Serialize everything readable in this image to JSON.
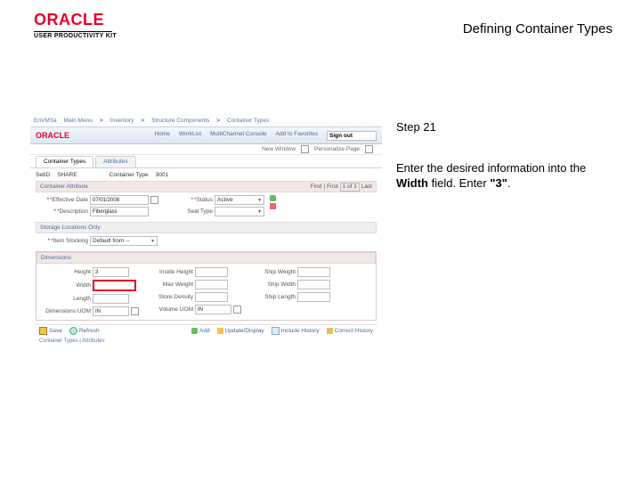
{
  "brand": {
    "oracle": "ORACLE",
    "sub": "USER PRODUCTIVITY KIT"
  },
  "title": "Defining Container Types",
  "instr": {
    "step": "Step 21",
    "line1": "Enter the desired information into the ",
    "bold": "Width",
    "line2": " field. Enter ",
    "quoted": "\"3\"",
    "line3": "."
  },
  "shot": {
    "bc": {
      "a": "EnVMSa",
      "b": "Main Menu",
      "c": "Inventory",
      "d": "Structure Components",
      "e": "Container Types"
    },
    "nav": {
      "a": "Home",
      "b": "WorkList",
      "c": "MultiChannel Console",
      "d": "Add to Favorites",
      "e": "Sign out"
    },
    "subrow": {
      "a": "New Window",
      "b": "Personalize Page"
    },
    "tabs": {
      "a": "Container Types",
      "b": "Attributes"
    },
    "hdr": {
      "setid_lbl": "SetID",
      "setid_val": "SHARE",
      "ct_lbl": "Container Type",
      "ct_val": "3001"
    },
    "pager": {
      "find": "Find",
      "first": "First",
      "ix": "1 of 1",
      "last": "Last"
    },
    "fields": {
      "effdate_lbl": "*Effective Date",
      "effdate_val": "07/01/2008",
      "status_lbl": "*Status",
      "status_val": "Active",
      "desc_lbl": "*Description",
      "desc_val": "Fiberglass",
      "seal_lbl": "Seal Type",
      "seal_val": ""
    },
    "storloc": {
      "hdr": "Storage Locations Only",
      "maxstor_lbl": "*Item Stocking",
      "maxstor_val": "Default from --"
    },
    "dims": {
      "hdr": "Dimensions",
      "height_lbl": "Height",
      "height_val": "3",
      "width_lbl": "Width",
      "width_val": "",
      "length_lbl": "Length",
      "length_val": "",
      "dimuom_lbl": "Dimensions UOM",
      "dimuom_val": "IN",
      "inw_lbl": "Inside Height",
      "inw_val": "",
      "maxw_lbl": "Max Weight",
      "maxw_val": "",
      "storecap_lbl": "Store Density",
      "storecap_val": "",
      "vol_lbl": "Volume UOM",
      "vol_val": "IN",
      "shipw_lbl": "Ship Weight",
      "shipw_val": "",
      "wcap_lbl": "Ship Width",
      "wcap_val": "",
      "shipl_lbl": "Ship Length",
      "shipl_val": ""
    },
    "btns": {
      "save": "Save",
      "refresh": "Refresh",
      "add": "Add",
      "upd": "Update/Display",
      "hist": "Include History",
      "corr": "Correct History"
    },
    "foot": "Container Types | Attributes"
  }
}
